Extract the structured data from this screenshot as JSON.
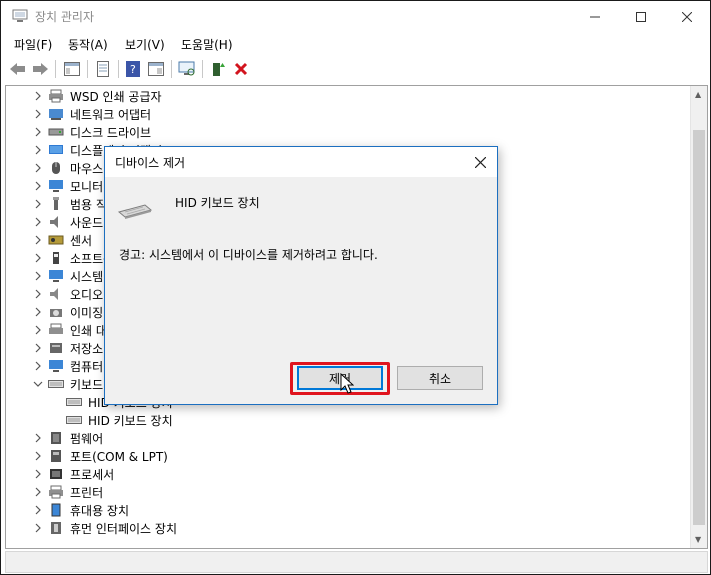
{
  "window": {
    "title": "장치 관리자"
  },
  "menu": [
    "파일(F)",
    "동작(A)",
    "보기(V)",
    "도움말(H)"
  ],
  "toolbar_icons": [
    "back-arrow-icon",
    "forward-arrow-icon",
    "show-hide-tree-icon",
    "properties-icon",
    "help-icon",
    "action-view-icon",
    "scan-hardware-icon",
    "update-driver-icon",
    "uninstall-device-icon"
  ],
  "tree": [
    {
      "label": "WSD 인쇄 공급자",
      "icon": "printer-icon",
      "expanded": false
    },
    {
      "label": "네트워크 어댑터",
      "icon": "network-adapter-icon",
      "expanded": false
    },
    {
      "label": "디스크 드라이브",
      "icon": "disk-drive-icon",
      "expanded": false
    },
    {
      "label": "디스플레이 어댑터",
      "icon": "display-adapter-icon",
      "expanded": false
    },
    {
      "label": "마우스 및 기타 포인팅 장치",
      "icon": "mouse-icon",
      "expanded": false
    },
    {
      "label": "모니터",
      "icon": "monitor-icon",
      "expanded": false
    },
    {
      "label": "범용 직렬 버스 컨트롤러",
      "icon": "usb-icon",
      "expanded": false
    },
    {
      "label": "사운드, 비디오 및 게임 컨트롤러",
      "icon": "sound-icon",
      "expanded": false
    },
    {
      "label": "센서",
      "icon": "sensor-icon",
      "expanded": false
    },
    {
      "label": "소프트웨어 장치",
      "icon": "software-device-icon",
      "expanded": false
    },
    {
      "label": "시스템 장치",
      "icon": "system-device-icon",
      "expanded": false
    },
    {
      "label": "오디오 입력 및 출력",
      "icon": "audio-icon",
      "expanded": false
    },
    {
      "label": "이미징 장치",
      "icon": "imaging-icon",
      "expanded": false
    },
    {
      "label": "인쇄 대기열",
      "icon": "print-queue-icon",
      "expanded": false
    },
    {
      "label": "저장소 컨트롤러",
      "icon": "storage-controller-icon",
      "expanded": false
    },
    {
      "label": "컴퓨터",
      "icon": "computer-icon",
      "expanded": false
    },
    {
      "label": "키보드",
      "icon": "keyboard-icon",
      "expanded": true
    },
    {
      "label": "HID 키보드 장치",
      "icon": "keyboard-device-icon",
      "child": true
    },
    {
      "label": "HID 키보드 장치",
      "icon": "keyboard-device-icon",
      "child": true
    },
    {
      "label": "펌웨어",
      "icon": "firmware-icon",
      "expanded": false
    },
    {
      "label": "포트(COM & LPT)",
      "icon": "port-icon",
      "expanded": false
    },
    {
      "label": "프로세서",
      "icon": "processor-icon",
      "expanded": false
    },
    {
      "label": "프린터",
      "icon": "printer-icon",
      "expanded": false
    },
    {
      "label": "휴대용 장치",
      "icon": "portable-device-icon",
      "expanded": false
    },
    {
      "label": "휴먼 인터페이스 장치",
      "icon": "hid-icon",
      "expanded": false
    }
  ],
  "dialog": {
    "title": "디바이스 제거",
    "device_name": "HID 키보드 장치",
    "warning": "경고: 시스템에서 이 디바이스를 제거하려고 합니다.",
    "ok_label": "제거",
    "cancel_label": "취소",
    "highlight_color": "#e0141e"
  }
}
